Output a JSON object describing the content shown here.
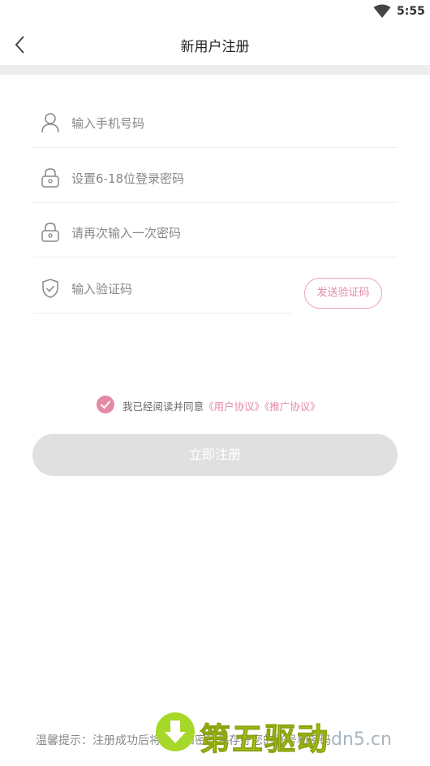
{
  "status_bar": {
    "time": "5:55",
    "wifi_icon": "wifi-icon"
  },
  "nav": {
    "title": "新用户注册",
    "back_icon": "chevron-left-icon"
  },
  "form": {
    "phone": {
      "placeholder": "输入手机号码",
      "icon": "user-icon"
    },
    "password": {
      "placeholder": "设置6-18位登录密码",
      "icon": "lock-icon"
    },
    "confirm_password": {
      "placeholder": "请再次输入一次密码",
      "icon": "lock-icon"
    },
    "code": {
      "placeholder": "输入验证码",
      "icon": "shield-check-icon"
    },
    "send_code_label": "发送验证码"
  },
  "agreement": {
    "prefix": "我已经阅读并同意",
    "user_agreement": "《用户协议》",
    "promo_agreement": "《推广协议》",
    "checked": true
  },
  "register_label": "立即注册",
  "tip": "温馨提示：注册成功后将号码和密码保存好您的账号和密码",
  "watermark": {
    "text": "第五驱动",
    "site": "dn5.cn"
  },
  "colors": {
    "accent": "#e48aa4",
    "button_disabled": "#e0e0e0",
    "band": "#ededed"
  }
}
